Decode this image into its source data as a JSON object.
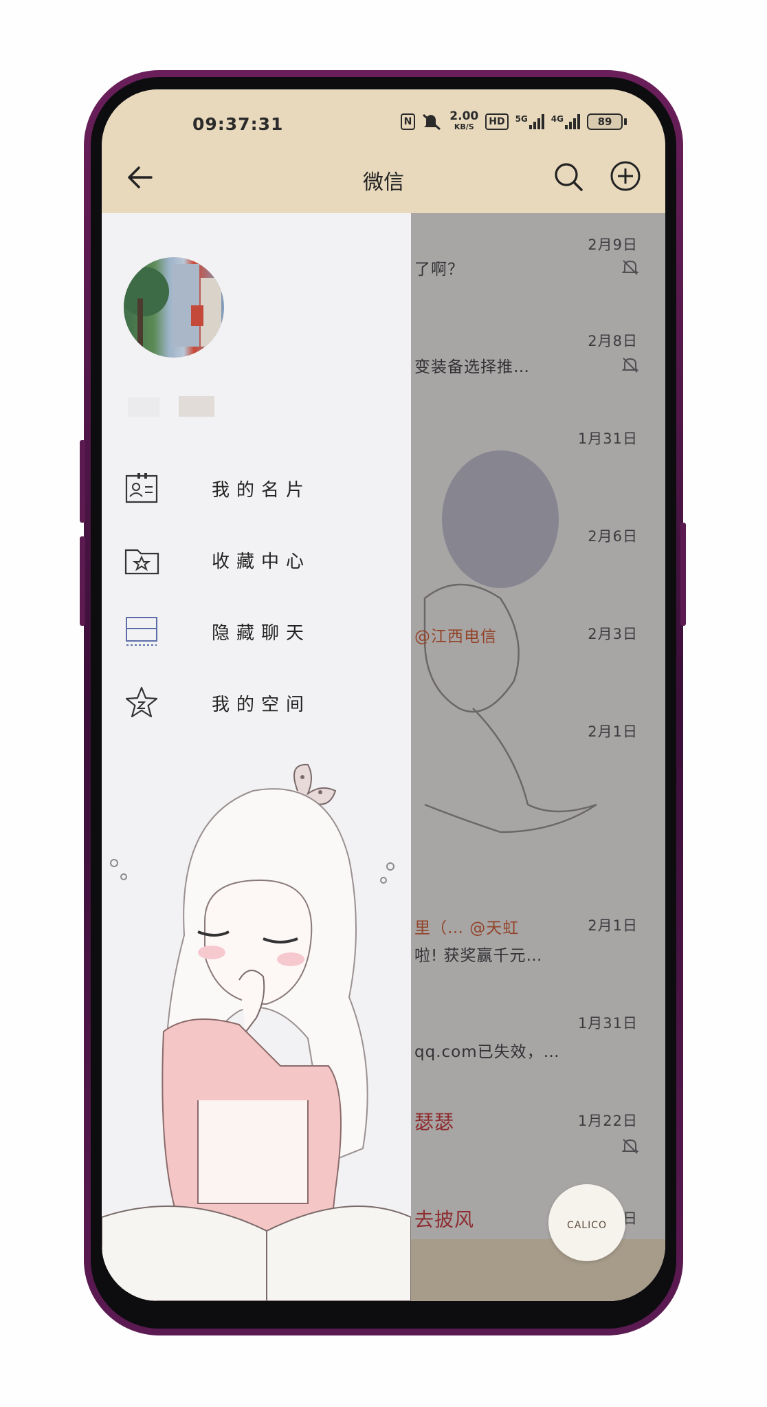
{
  "status": {
    "time": "09:37:31",
    "net_speed": "2.00",
    "net_unit": "KB/S",
    "hd": "HD",
    "net1": "5G",
    "net2": "4G",
    "battery": "89"
  },
  "toolbar": {
    "title": "微信"
  },
  "drawer": {
    "menu": [
      {
        "label": "我的名片",
        "icon": "id-card-icon"
      },
      {
        "label": "收藏中心",
        "icon": "folder-star-icon"
      },
      {
        "label": "隐藏聊天",
        "icon": "hidden-chat-icon"
      },
      {
        "label": "我的空间",
        "icon": "star-space-icon"
      }
    ]
  },
  "chats": [
    {
      "date": "2月9日",
      "snippet": "了啊？",
      "muted": true
    },
    {
      "date": "2月8日",
      "snippet": "变装备选择推…",
      "muted": true
    },
    {
      "date": "1月31日",
      "snippet": ""
    },
    {
      "date": "2月6日",
      "snippet": ""
    },
    {
      "date": "2月3日",
      "snippet": "@江西电信"
    },
    {
      "date": "2月1日",
      "snippet": ""
    },
    {
      "date": "2月1日",
      "snippet": "里（… @天虹",
      "snippet2": "啦! 获奖赢千元…"
    },
    {
      "date": "1月31日",
      "snippet": "qq.com已失效，…"
    },
    {
      "date": "1月22日",
      "snippet": "瑟瑟",
      "muted": true
    },
    {
      "date": "日",
      "snippet": "去披风"
    }
  ],
  "fab": {
    "label": "CALICO"
  },
  "colors": {
    "toolbar": "#e8d9bd",
    "drawer": "#f2f1f3",
    "accent_orange": "#c9562a"
  }
}
